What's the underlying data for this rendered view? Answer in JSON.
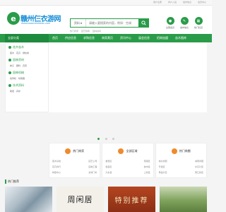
{
  "topbar": {
    "links": [
      "用户注册",
      "商户入驻",
      "发布信息",
      "会员中心"
    ]
  },
  "header": {
    "logo_title": "赣州仨衣游网",
    "logo_url": "WWW.NONGYESHENG.COM",
    "search": {
      "category": "资料",
      "placeholder": "请输入要搜索的内容，例如：空调"
    },
    "hot_words": [
      "热门搜索",
      "园艺植物",
      "园林资材"
    ],
    "quick": [
      {
        "icon": "user-icon",
        "label": "注册会员"
      },
      {
        "icon": "edit-icon",
        "label": "发布信息"
      },
      {
        "icon": "grid-icon",
        "label": "热门栏目"
      }
    ]
  },
  "nav": {
    "category_label": "全部分类",
    "items": [
      "首页",
      "供应信息",
      "求购信息",
      "商家黄页",
      "资讯中心",
      "展会信息",
      "招商加盟",
      "苗木图库",
      "技术资料",
      "园林企业"
    ]
  },
  "sidebar": {
    "groups": [
      {
        "title": "花卉苗木",
        "links": [
          "苗木",
          "花卉",
          "绿化树"
        ]
      },
      {
        "title": "园林资材",
        "links": [
          "种子",
          "肥料",
          "农药"
        ]
      },
      {
        "title": "园林机械",
        "links": [
          "剪草机",
          "喷雾器"
        ]
      },
      {
        "title": "技术资料",
        "links": [
          "栽培",
          "养护"
        ]
      }
    ]
  },
  "cards": [
    {
      "title": "热门商家",
      "rows": [
        [
          "苗木基地",
          "园艺公司"
        ],
        [
          "花卉商行",
          "园林工程"
        ],
        [
          "种苗中心",
          "资材门市"
        ]
      ]
    },
    {
      "title": "全部区域",
      "rows": [
        [
          "章贡区",
          "南康区"
        ],
        [
          "赣县区",
          "信丰县"
        ],
        [
          "大余县",
          "上犹县"
        ]
      ]
    },
    {
      "title": "热门商圈",
      "rows": [
        [
          "城北商圈",
          "城南商圈"
        ],
        [
          "开发区",
          "水东片区"
        ],
        [
          "黄金片区",
          "蓉江新区"
        ]
      ]
    }
  ],
  "cases": {
    "title": "热门推荐",
    "sign_text": "特别推荐",
    "calli_text": "周闲居"
  },
  "colors": {
    "brand_green": "#2a9c49",
    "accent_orange": "#f08a2c",
    "logo_blue": "#1a8fd6"
  }
}
